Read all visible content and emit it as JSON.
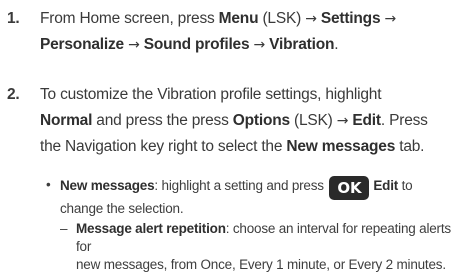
{
  "step1": {
    "number": "1.",
    "text_a": "From Home screen, press ",
    "menu": "Menu",
    "lsk_a": " (LSK) ",
    "arrow": "→",
    "settings": "Settings",
    "personalize": "Personalize",
    "sound_profiles": "Sound profiles",
    "vibration": "Vibration",
    "period": "."
  },
  "step2": {
    "number": "2.",
    "text_a": "To customize the Vibration profile settings, highlight",
    "normal": "Normal",
    "text_b": " and press the press ",
    "options": "Options",
    "lsk": " (LSK) ",
    "arrow": "→",
    "edit": "Edit",
    "text_c": ". Press",
    "text_d": "the Navigation key right to select the ",
    "new_messages_tab": "New messages",
    "text_e": " tab."
  },
  "bullet": {
    "dot": "•",
    "label": "New messages",
    "text_a": ": highlight a setting and press ",
    "ok_key": "OK",
    "edit": "Edit",
    "text_b": " to",
    "text_c": "change the selection."
  },
  "sub_item": {
    "dash": "–",
    "label": "Message alert repetition",
    "text_a": ": choose an interval for repeating alerts for",
    "text_b": "new messages, from Once, Every 1 minute, or Every 2 minutes."
  }
}
